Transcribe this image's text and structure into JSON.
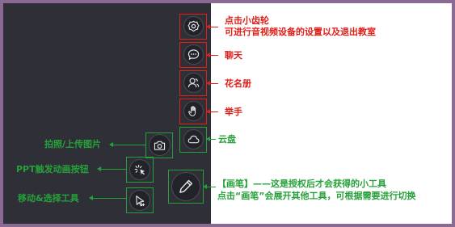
{
  "colors": {
    "panel": "#2f3037",
    "frame": "#8a6a92",
    "red": "#e0201a",
    "green": "#26a13a"
  },
  "tools": {
    "settings": {
      "icon": "gear-icon",
      "label_line1": "点击小齿轮",
      "label_line2": "可进行音视频设备的设置以及退出教室"
    },
    "chat": {
      "icon": "chat-bubble-icon",
      "label": "聊天"
    },
    "roster": {
      "icon": "users-icon",
      "label": "花名册"
    },
    "raise_hand": {
      "icon": "hand-icon",
      "label": "举手"
    },
    "cloud": {
      "icon": "cloud-icon",
      "label": "云盘"
    },
    "camera": {
      "icon": "camera-icon",
      "label": "拍照/上传图片"
    },
    "ppt_anim": {
      "icon": "pointer-click-icon",
      "label": "PPT触发动画按钮"
    },
    "move_select": {
      "icon": "select-cursor-icon",
      "label": "移动&选择工具"
    },
    "pen": {
      "icon": "pen-icon",
      "label_line1": "【画笔】——这是授权后才会获得的小工具",
      "label_line2": "点击“画笔”会展开其他工具，可根据需要进行切换"
    }
  }
}
